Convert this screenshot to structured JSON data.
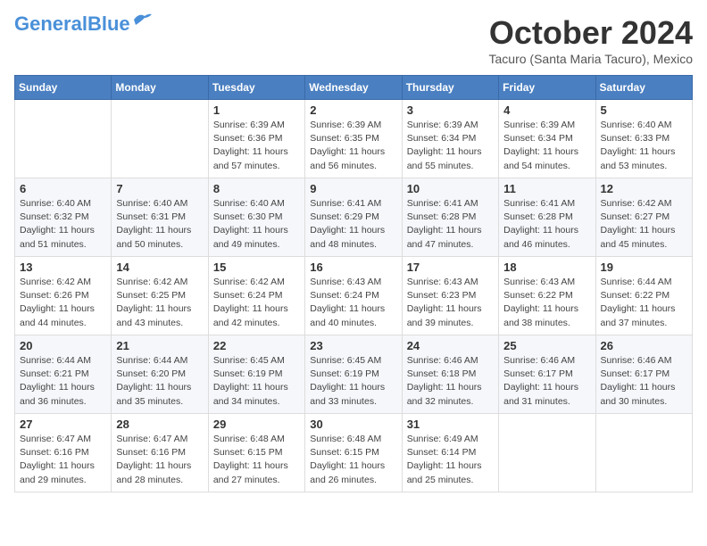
{
  "logo": {
    "general": "General",
    "blue": "Blue"
  },
  "header": {
    "month": "October 2024",
    "subtitle": "Tacuro (Santa Maria Tacuro), Mexico"
  },
  "weekdays": [
    "Sunday",
    "Monday",
    "Tuesday",
    "Wednesday",
    "Thursday",
    "Friday",
    "Saturday"
  ],
  "weeks": [
    [
      null,
      null,
      {
        "day": 1,
        "sunrise": "6:39 AM",
        "sunset": "6:36 PM",
        "daylight": "11 hours and 57 minutes."
      },
      {
        "day": 2,
        "sunrise": "6:39 AM",
        "sunset": "6:35 PM",
        "daylight": "11 hours and 56 minutes."
      },
      {
        "day": 3,
        "sunrise": "6:39 AM",
        "sunset": "6:34 PM",
        "daylight": "11 hours and 55 minutes."
      },
      {
        "day": 4,
        "sunrise": "6:39 AM",
        "sunset": "6:34 PM",
        "daylight": "11 hours and 54 minutes."
      },
      {
        "day": 5,
        "sunrise": "6:40 AM",
        "sunset": "6:33 PM",
        "daylight": "11 hours and 53 minutes."
      }
    ],
    [
      {
        "day": 6,
        "sunrise": "6:40 AM",
        "sunset": "6:32 PM",
        "daylight": "11 hours and 51 minutes."
      },
      {
        "day": 7,
        "sunrise": "6:40 AM",
        "sunset": "6:31 PM",
        "daylight": "11 hours and 50 minutes."
      },
      {
        "day": 8,
        "sunrise": "6:40 AM",
        "sunset": "6:30 PM",
        "daylight": "11 hours and 49 minutes."
      },
      {
        "day": 9,
        "sunrise": "6:41 AM",
        "sunset": "6:29 PM",
        "daylight": "11 hours and 48 minutes."
      },
      {
        "day": 10,
        "sunrise": "6:41 AM",
        "sunset": "6:28 PM",
        "daylight": "11 hours and 47 minutes."
      },
      {
        "day": 11,
        "sunrise": "6:41 AM",
        "sunset": "6:28 PM",
        "daylight": "11 hours and 46 minutes."
      },
      {
        "day": 12,
        "sunrise": "6:42 AM",
        "sunset": "6:27 PM",
        "daylight": "11 hours and 45 minutes."
      }
    ],
    [
      {
        "day": 13,
        "sunrise": "6:42 AM",
        "sunset": "6:26 PM",
        "daylight": "11 hours and 44 minutes."
      },
      {
        "day": 14,
        "sunrise": "6:42 AM",
        "sunset": "6:25 PM",
        "daylight": "11 hours and 43 minutes."
      },
      {
        "day": 15,
        "sunrise": "6:42 AM",
        "sunset": "6:24 PM",
        "daylight": "11 hours and 42 minutes."
      },
      {
        "day": 16,
        "sunrise": "6:43 AM",
        "sunset": "6:24 PM",
        "daylight": "11 hours and 40 minutes."
      },
      {
        "day": 17,
        "sunrise": "6:43 AM",
        "sunset": "6:23 PM",
        "daylight": "11 hours and 39 minutes."
      },
      {
        "day": 18,
        "sunrise": "6:43 AM",
        "sunset": "6:22 PM",
        "daylight": "11 hours and 38 minutes."
      },
      {
        "day": 19,
        "sunrise": "6:44 AM",
        "sunset": "6:22 PM",
        "daylight": "11 hours and 37 minutes."
      }
    ],
    [
      {
        "day": 20,
        "sunrise": "6:44 AM",
        "sunset": "6:21 PM",
        "daylight": "11 hours and 36 minutes."
      },
      {
        "day": 21,
        "sunrise": "6:44 AM",
        "sunset": "6:20 PM",
        "daylight": "11 hours and 35 minutes."
      },
      {
        "day": 22,
        "sunrise": "6:45 AM",
        "sunset": "6:19 PM",
        "daylight": "11 hours and 34 minutes."
      },
      {
        "day": 23,
        "sunrise": "6:45 AM",
        "sunset": "6:19 PM",
        "daylight": "11 hours and 33 minutes."
      },
      {
        "day": 24,
        "sunrise": "6:46 AM",
        "sunset": "6:18 PM",
        "daylight": "11 hours and 32 minutes."
      },
      {
        "day": 25,
        "sunrise": "6:46 AM",
        "sunset": "6:17 PM",
        "daylight": "11 hours and 31 minutes."
      },
      {
        "day": 26,
        "sunrise": "6:46 AM",
        "sunset": "6:17 PM",
        "daylight": "11 hours and 30 minutes."
      }
    ],
    [
      {
        "day": 27,
        "sunrise": "6:47 AM",
        "sunset": "6:16 PM",
        "daylight": "11 hours and 29 minutes."
      },
      {
        "day": 28,
        "sunrise": "6:47 AM",
        "sunset": "6:16 PM",
        "daylight": "11 hours and 28 minutes."
      },
      {
        "day": 29,
        "sunrise": "6:48 AM",
        "sunset": "6:15 PM",
        "daylight": "11 hours and 27 minutes."
      },
      {
        "day": 30,
        "sunrise": "6:48 AM",
        "sunset": "6:15 PM",
        "daylight": "11 hours and 26 minutes."
      },
      {
        "day": 31,
        "sunrise": "6:49 AM",
        "sunset": "6:14 PM",
        "daylight": "11 hours and 25 minutes."
      },
      null,
      null
    ]
  ],
  "labels": {
    "sunrise": "Sunrise:",
    "sunset": "Sunset:",
    "daylight": "Daylight:"
  }
}
